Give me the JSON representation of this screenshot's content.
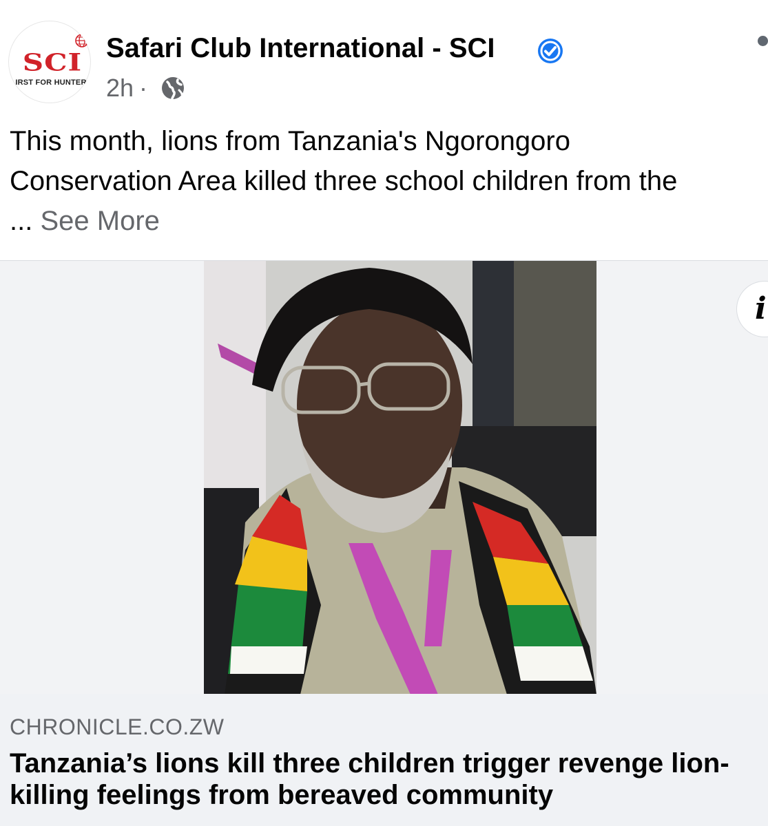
{
  "post": {
    "page_name": "Safari Club International - SCI",
    "verified_icon": "verified-badge-icon",
    "timestamp": "2h",
    "separator": "·",
    "audience_icon": "globe-icon",
    "avatar": {
      "logo_text": "SCI",
      "logo_subtext": "IRST FOR HUNTER"
    },
    "text_lines": [
      "This month, lions from Tanzania's Ngorongoro",
      "Conservation Area killed three school children from the"
    ],
    "ellipsis": "...",
    "see_more_label": "See More"
  },
  "link_preview": {
    "domain": "CHRONICLE.CO.ZW",
    "headline_lines": [
      "Tanzania’s lions kill three children trigger revenge lion-",
      "killing feelings from bereaved community"
    ],
    "info_label": "i"
  },
  "colors": {
    "brand_red": "#d1232a",
    "verified_blue": "#1877f2",
    "secondary_text": "#65676b",
    "link_bg": "#f0f2f5"
  }
}
